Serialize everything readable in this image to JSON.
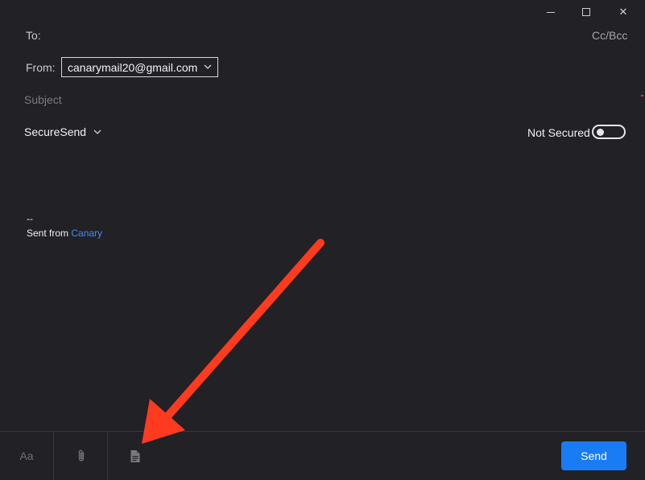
{
  "window": {
    "controls": {
      "minimize_icon": "minimize-icon",
      "maximize_icon": "maximize-icon",
      "close_glyph": "✕"
    }
  },
  "compose": {
    "to_label": "To:",
    "cc_bcc": "Cc/Bcc",
    "from_label": "From:",
    "from_account": "canarymail20@gmail.com",
    "subject_placeholder": "Subject",
    "securesend_label": "SecureSend",
    "security_status": "Not Secured",
    "security_toggle_on": false
  },
  "body": {
    "signature_separator": "--",
    "signature_prefix": "Sent from ",
    "signature_link": "Canary"
  },
  "toolbar": {
    "font_label": "Aa",
    "attach_icon": "paperclip-icon",
    "template_icon": "document-icon",
    "send_label": "Send"
  },
  "colors": {
    "background": "#222125",
    "accent": "#1a7cf5",
    "link": "#3e8ef7",
    "annotation_arrow": "#ff3b1f"
  }
}
